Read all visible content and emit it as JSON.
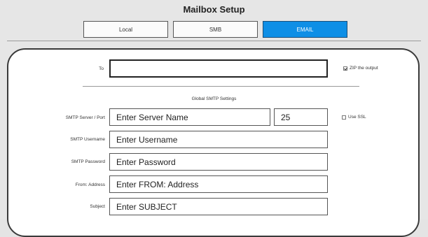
{
  "window": {
    "title": "Mailbox Setup"
  },
  "tabs": [
    {
      "label": "Local",
      "active": false
    },
    {
      "label": "SMB",
      "active": false
    },
    {
      "label": "EMAIL",
      "active": true
    }
  ],
  "form": {
    "to_label": "To",
    "to_value": "",
    "zip_label": "ZIP the output",
    "zip_checked": true,
    "section_title": "Global SMTP Settings",
    "server_label": "SMTP Server / Port",
    "server_value": "Enter Server Name",
    "port_value": "25",
    "ssl_label": "Use SSL",
    "ssl_checked": false,
    "username_label": "SMTP Username",
    "username_value": "Enter Username",
    "password_label": "SMTP Password",
    "password_value": "Enter Password",
    "from_label": "From: Address",
    "from_value": "Enter FROM: Address",
    "subject_label": "Subject",
    "subject_value": "Enter SUBJECT"
  },
  "colors": {
    "active_tab": "#0e8fe6",
    "background": "#e4e4e4",
    "panel": "#ffffff"
  }
}
